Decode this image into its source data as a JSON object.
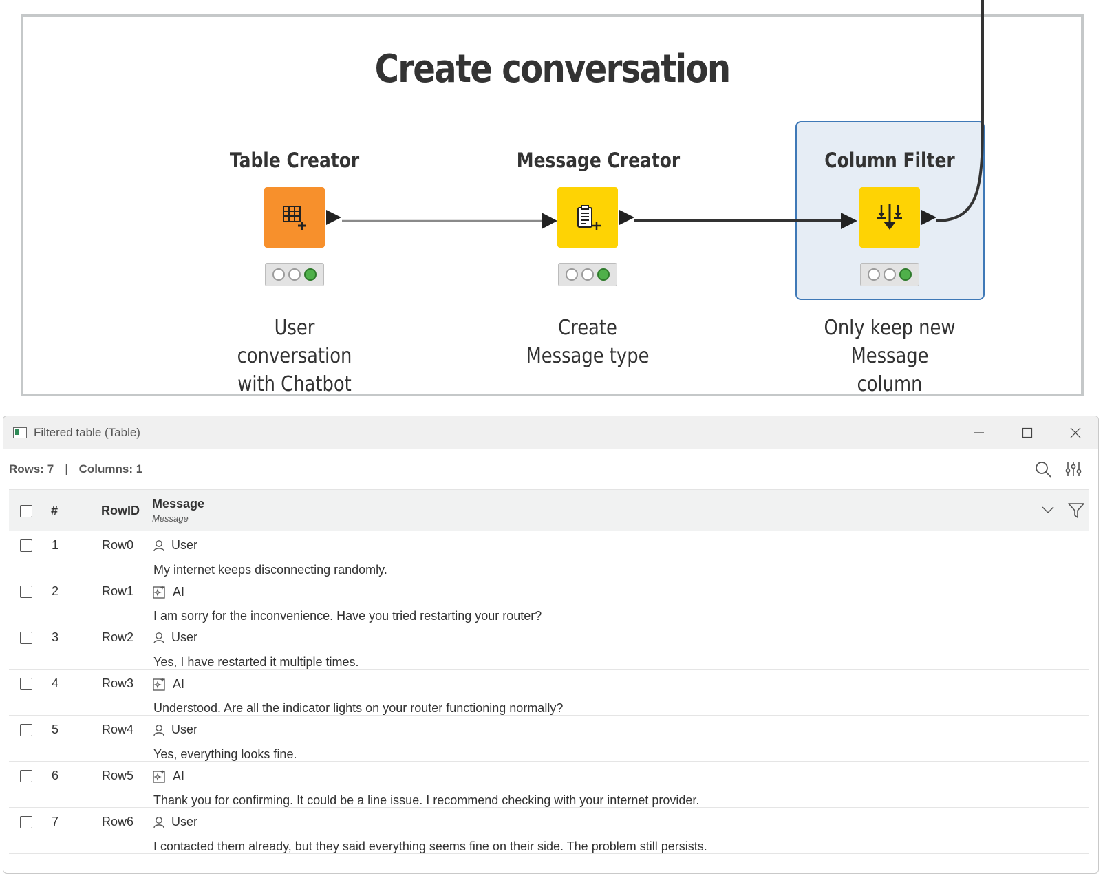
{
  "annotation": {
    "title": "Create conversation"
  },
  "nodes": [
    {
      "name": "Table Creator",
      "description_line1": "User conversation",
      "description_line2": "with Chatbot",
      "color": "#f7902c",
      "icon": "table-plus-icon",
      "status": "executed"
    },
    {
      "name": "Message Creator",
      "description_line1": "Create Message type",
      "description_line2": "",
      "color": "#fed304",
      "icon": "message-plus-icon",
      "status": "executed"
    },
    {
      "name": "Column Filter",
      "description_line1": "Only keep new",
      "description_line2": "Message column",
      "color": "#fed304",
      "icon": "column-filter-icon",
      "status": "executed",
      "selected": true
    }
  ],
  "window": {
    "title": "Filtered table (Table)",
    "rows_label": "Rows: 7",
    "separator": "|",
    "columns_label": "Columns: 1"
  },
  "table": {
    "headers": {
      "index": "#",
      "rowid": "RowID",
      "column": "Message",
      "column_type": "Message"
    },
    "rows": [
      {
        "index": "1",
        "rowid": "Row0",
        "role": "User",
        "text": "My internet keeps disconnecting randomly."
      },
      {
        "index": "2",
        "rowid": "Row1",
        "role": "AI",
        "text": "I am sorry for the inconvenience. Have you tried restarting your router?"
      },
      {
        "index": "3",
        "rowid": "Row2",
        "role": "User",
        "text": "Yes, I have restarted it multiple times."
      },
      {
        "index": "4",
        "rowid": "Row3",
        "role": "AI",
        "text": "Understood. Are all the indicator lights on your router functioning normally?"
      },
      {
        "index": "5",
        "rowid": "Row4",
        "role": "User",
        "text": "Yes, everything looks fine."
      },
      {
        "index": "6",
        "rowid": "Row5",
        "role": "AI",
        "text": "Thank you for confirming. It could be a line issue. I recommend checking with your internet provider."
      },
      {
        "index": "7",
        "rowid": "Row6",
        "role": "User",
        "text": "I contacted them already, but they said everything seems fine on their side. The problem still persists."
      }
    ]
  }
}
